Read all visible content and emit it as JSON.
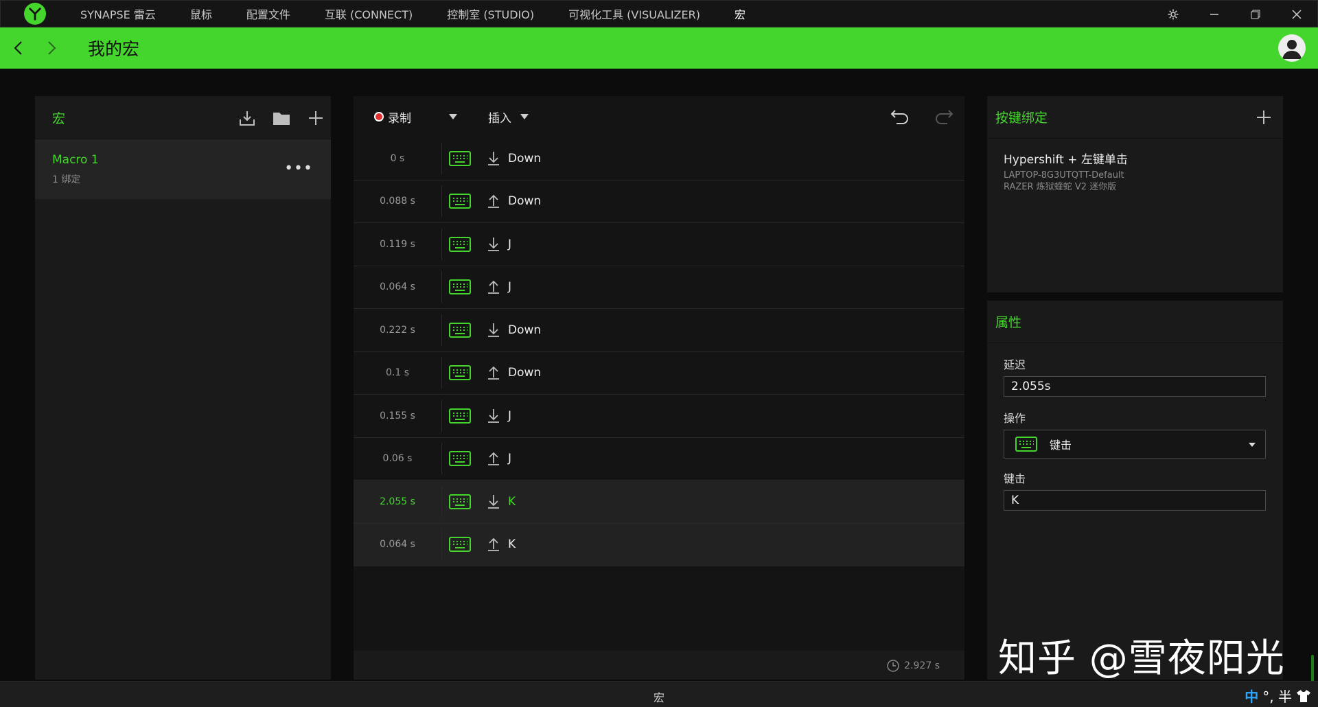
{
  "titlebar": {
    "nav": [
      "SYNAPSE 雷云",
      "鼠标",
      "配置文件",
      "互联 (CONNECT)",
      "控制室 (STUDIO)",
      "可视化工具 (VISUALIZER)",
      "宏"
    ],
    "active_index": 6
  },
  "header": {
    "title": "我的宏"
  },
  "left": {
    "title": "宏",
    "macro": {
      "name": "Macro 1",
      "sub": "1 绑定"
    }
  },
  "editor": {
    "record_label": "录制",
    "insert_label": "插入",
    "rows": [
      {
        "time": "0 s",
        "dir": "down",
        "key": "Down"
      },
      {
        "time": "0.088 s",
        "dir": "up",
        "key": "Down"
      },
      {
        "time": "0.119 s",
        "dir": "down",
        "key": "J"
      },
      {
        "time": "0.064 s",
        "dir": "up",
        "key": "J"
      },
      {
        "time": "0.222 s",
        "dir": "down",
        "key": "Down"
      },
      {
        "time": "0.1 s",
        "dir": "up",
        "key": "Down"
      },
      {
        "time": "0.155 s",
        "dir": "down",
        "key": "J"
      },
      {
        "time": "0.06 s",
        "dir": "up",
        "key": "J"
      },
      {
        "time": "2.055 s",
        "dir": "down",
        "key": "K",
        "selected": true
      },
      {
        "time": "0.064 s",
        "dir": "up",
        "key": "K",
        "highlight": true
      }
    ],
    "total": "2.927 s"
  },
  "binding": {
    "title": "按键绑定",
    "main": "Hypershift + 左键单击",
    "line1": "LAPTOP-8G3UTQTT-Default",
    "line2": "RAZER 炼狱蝰蛇 V2 迷你版"
  },
  "props": {
    "title": "属性",
    "delay_label": "延迟",
    "delay_value": "2.055s",
    "action_label": "操作",
    "action_value": "键击",
    "key_label": "键击",
    "key_value": "K"
  },
  "watermark": "知乎 @雪夜阳光",
  "statusbar": {
    "text": "宏",
    "ime": "中",
    "ime_extra": "°, 半"
  },
  "colors": {
    "accent": "#44d62c",
    "record": "#e23030",
    "ime": "#2ea7ff"
  }
}
